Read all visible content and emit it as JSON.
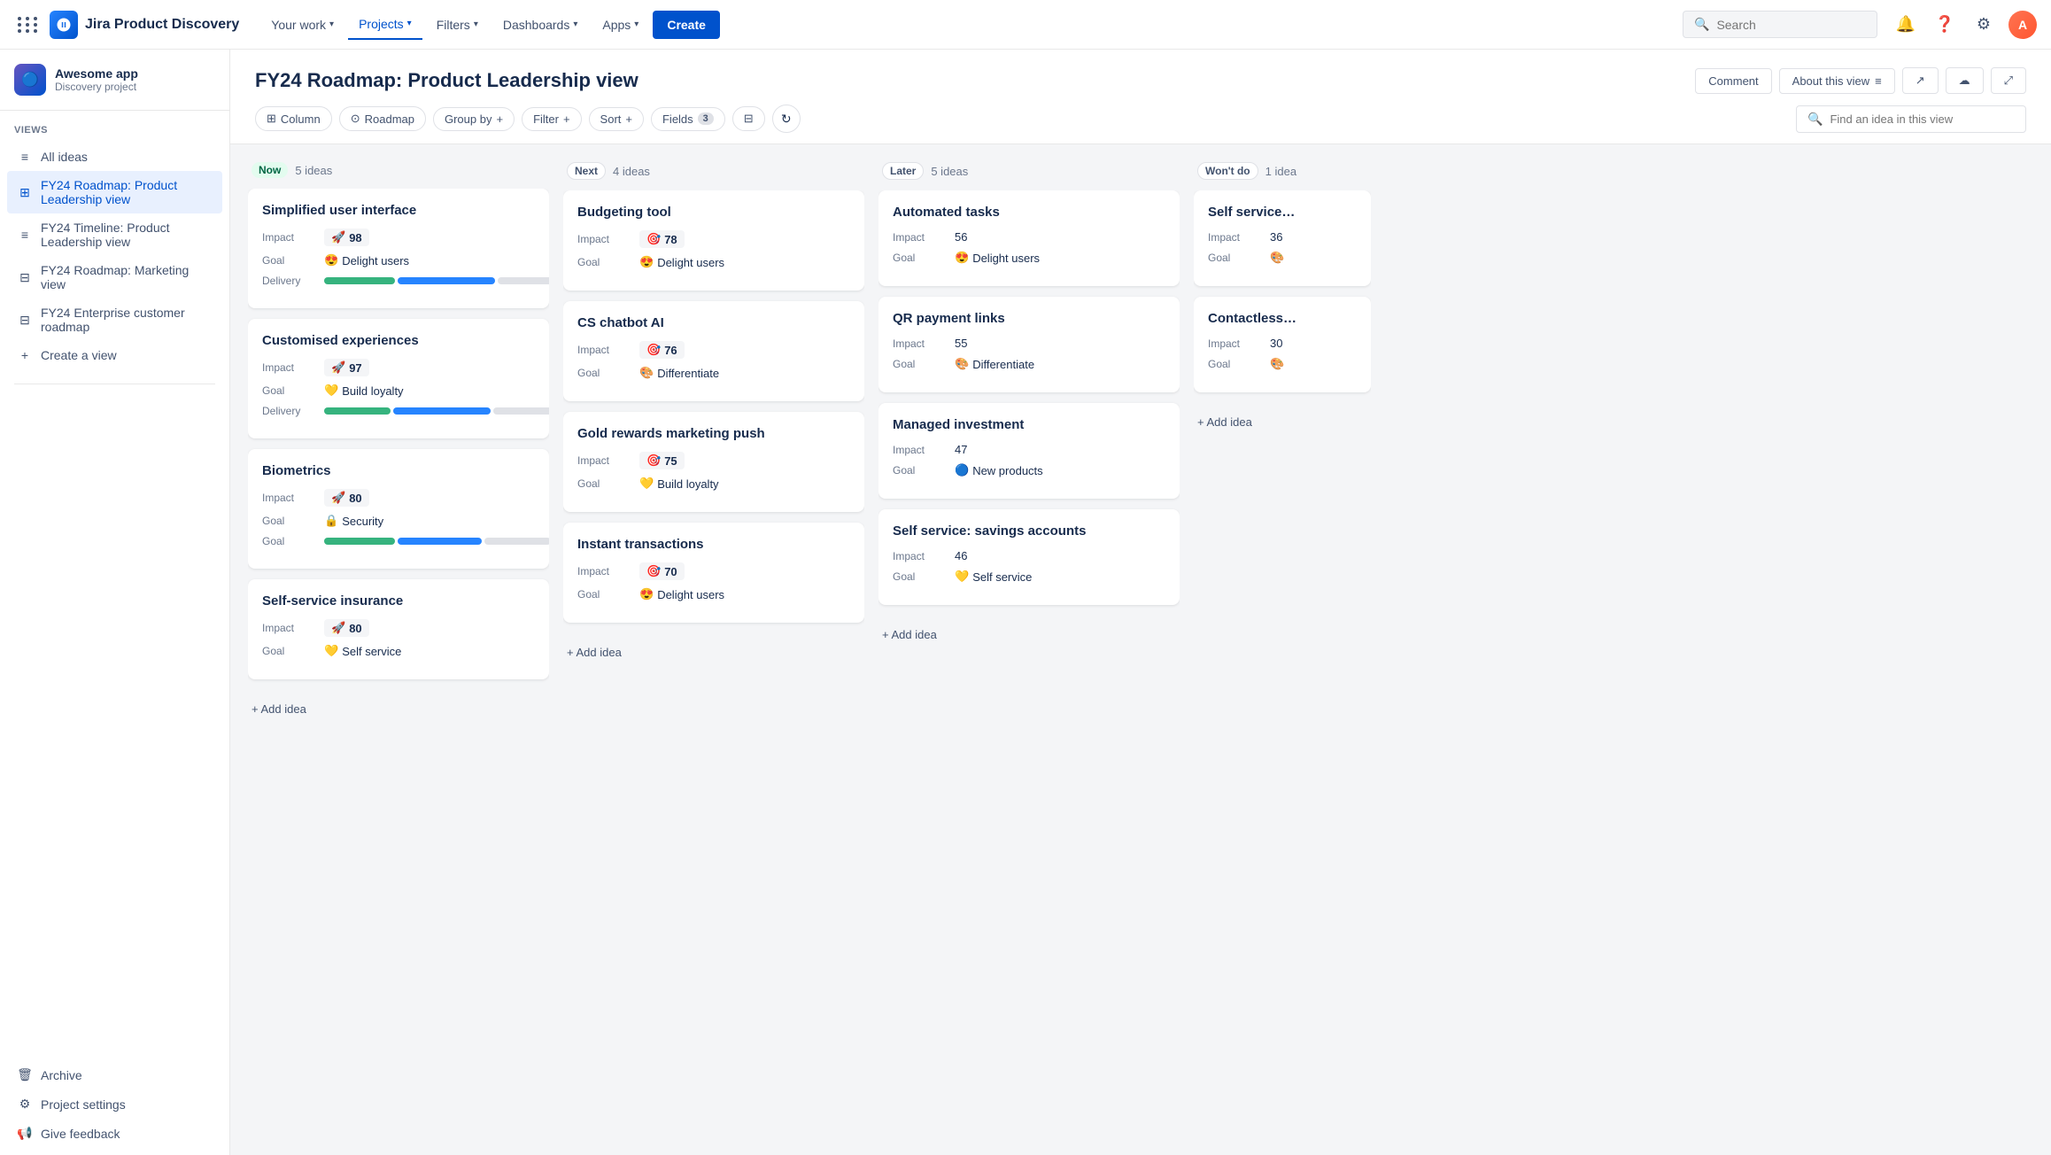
{
  "topnav": {
    "logo_text": "Jira Product Discovery",
    "nav_items": [
      {
        "label": "Your work",
        "active": false
      },
      {
        "label": "Projects",
        "active": true
      },
      {
        "label": "Filters",
        "active": false
      },
      {
        "label": "Dashboards",
        "active": false
      },
      {
        "label": "Apps",
        "active": false
      }
    ],
    "create_label": "Create",
    "search_placeholder": "Search"
  },
  "sidebar": {
    "project_name": "Awesome app",
    "project_type": "Discovery project",
    "views_label": "VIEWS",
    "views": [
      {
        "label": "All ideas",
        "icon": "≡",
        "active": false
      },
      {
        "label": "FY24 Roadmap: Product Leadership view",
        "icon": "⊞",
        "active": true
      },
      {
        "label": "FY24 Timeline: Product Leadership view",
        "icon": "≡",
        "active": false
      },
      {
        "label": "FY24 Roadmap: Marketing view",
        "icon": "⊟",
        "active": false
      },
      {
        "label": "FY24 Enterprise customer roadmap",
        "icon": "⊟",
        "active": false
      }
    ],
    "create_view_label": "Create a view",
    "archive_label": "Archive",
    "project_settings_label": "Project settings",
    "give_feedback_label": "Give feedback"
  },
  "page": {
    "title": "FY24 Roadmap: Product Leadership view",
    "comment_label": "Comment",
    "about_label": "About this view"
  },
  "toolbar": {
    "column_label": "Column",
    "roadmap_label": "Roadmap",
    "group_by_label": "Group by",
    "filter_label": "Filter",
    "sort_label": "Sort",
    "fields_label": "Fields",
    "fields_count": "3",
    "search_placeholder": "Find an idea in this view"
  },
  "columns": [
    {
      "id": "now",
      "label": "Now",
      "count": "5 ideas",
      "badge_class": "now",
      "cards": [
        {
          "title": "Simplified user interface",
          "impact": 98,
          "impact_icon": "🚀",
          "goal": "Delight users",
          "goal_icon": "😍",
          "delivery": {
            "green": 90,
            "blue": 120,
            "gray": 80
          }
        },
        {
          "title": "Customised experiences",
          "impact": 97,
          "impact_icon": "🚀",
          "goal": "Build loyalty",
          "goal_icon": "💛",
          "delivery": {
            "green": 80,
            "blue": 110,
            "gray": 80
          }
        },
        {
          "title": "Biometrics",
          "impact": 80,
          "impact_icon": "🚀",
          "goal": "Security",
          "goal_icon": "🔒",
          "delivery": {
            "green": 85,
            "blue": 100,
            "gray": 70
          }
        },
        {
          "title": "Self-service insurance",
          "impact": 80,
          "impact_icon": "🚀",
          "goal": "Self service",
          "goal_icon": "💛",
          "delivery": null
        }
      ]
    },
    {
      "id": "next",
      "label": "Next",
      "count": "4 ideas",
      "badge_class": "next",
      "cards": [
        {
          "title": "Budgeting tool",
          "impact": 78,
          "impact_icon": "🎯",
          "goal": "Delight users",
          "goal_icon": "😍",
          "delivery": null
        },
        {
          "title": "CS chatbot AI",
          "impact": 76,
          "impact_icon": "🎯",
          "goal": "Differentiate",
          "goal_icon": "🎨",
          "delivery": null
        },
        {
          "title": "Gold rewards marketing push",
          "impact": 75,
          "impact_icon": "🎯",
          "goal": "Build loyalty",
          "goal_icon": "💛",
          "delivery": null
        },
        {
          "title": "Instant transactions",
          "impact": 70,
          "impact_icon": "🎯",
          "goal": "Delight users",
          "goal_icon": "😍",
          "delivery": null
        }
      ]
    },
    {
      "id": "later",
      "label": "Later",
      "count": "5 ideas",
      "badge_class": "later",
      "cards": [
        {
          "title": "Automated tasks",
          "impact": 56,
          "impact_icon": null,
          "goal": "Delight users",
          "goal_icon": "😍",
          "delivery": null
        },
        {
          "title": "QR payment links",
          "impact": 55,
          "impact_icon": null,
          "goal": "Differentiate",
          "goal_icon": "🎨",
          "delivery": null
        },
        {
          "title": "Managed investment",
          "impact": 47,
          "impact_icon": null,
          "goal": "New products",
          "goal_icon": "🔵",
          "delivery": null
        },
        {
          "title": "Self service: savings accounts",
          "impact": 46,
          "impact_icon": null,
          "goal": "Self service",
          "goal_icon": "💛",
          "delivery": null
        }
      ]
    },
    {
      "id": "wontdo",
      "label": "Won't do",
      "count": "1 idea",
      "badge_class": "wontdo",
      "cards": [
        {
          "title": "Self service…",
          "impact": 36,
          "impact_icon": null,
          "goal": "",
          "goal_icon": "🎨",
          "delivery": null,
          "partial": true
        },
        {
          "title": "Contactless…",
          "impact": 30,
          "impact_icon": null,
          "goal": "",
          "goal_icon": "🎨",
          "delivery": null,
          "partial": true
        }
      ]
    }
  ],
  "add_idea_label": "+ Add idea"
}
